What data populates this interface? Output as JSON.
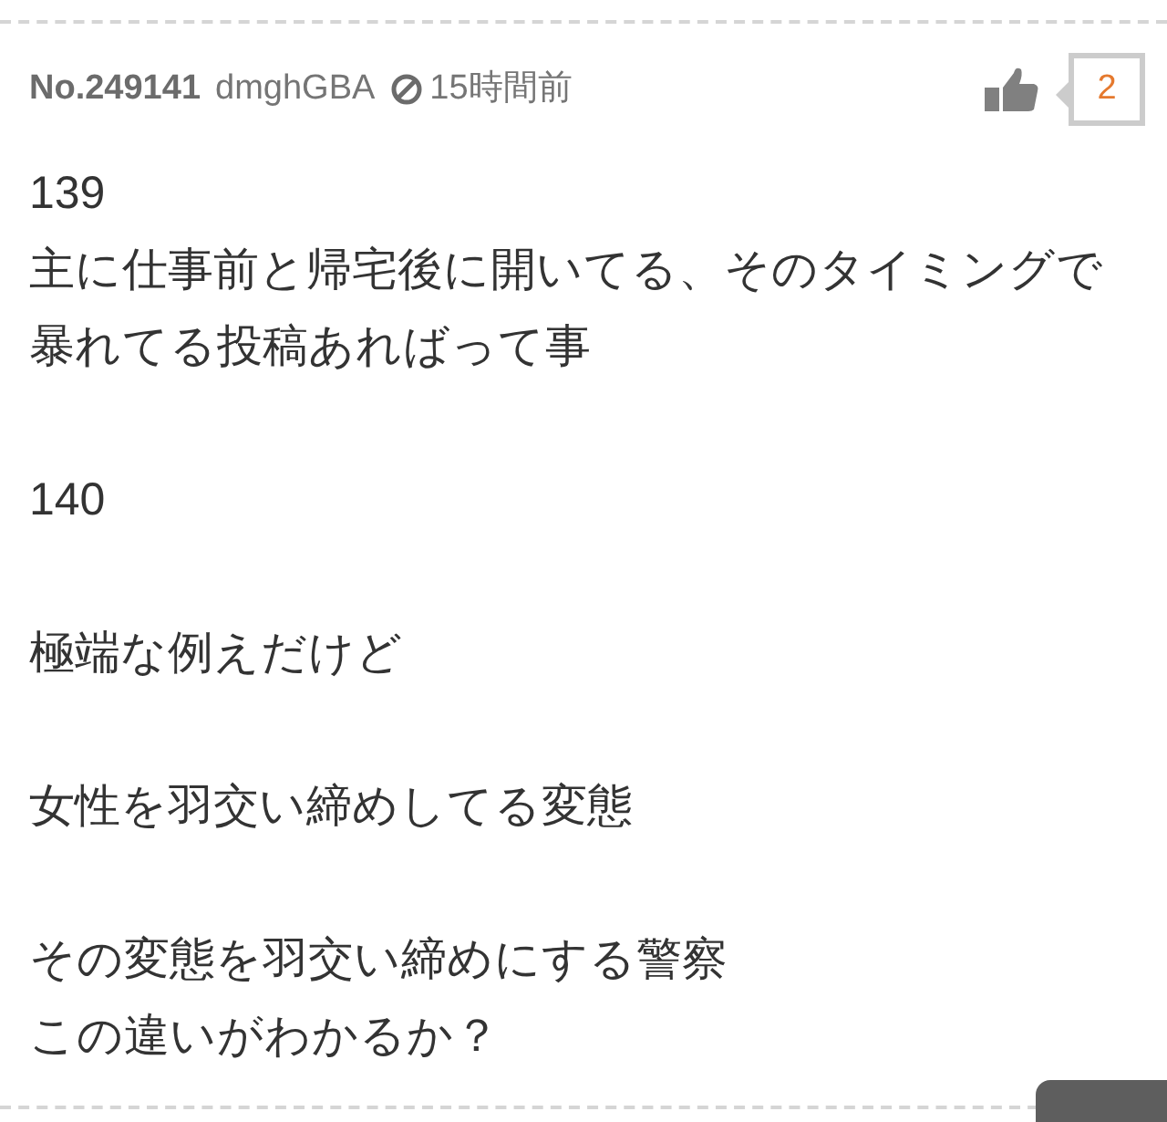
{
  "comment": {
    "number": "No.249141",
    "user": "dmghGBA",
    "time": "15時間前",
    "likes": "2",
    "paragraphs": [
      {
        "lines": [
          "139",
          "主に仕事前と帰宅後に開いてる、そのタイミングで",
          "暴れてる投稿あればって事"
        ]
      },
      {
        "lines": [
          "140"
        ]
      },
      {
        "lines": [
          "極端な例えだけど"
        ]
      },
      {
        "lines": [
          "女性を羽交い締めしてる変態"
        ]
      },
      {
        "lines": [
          "その変態を羽交い締めにする警察",
          "この違いがわかるか？"
        ]
      }
    ]
  }
}
